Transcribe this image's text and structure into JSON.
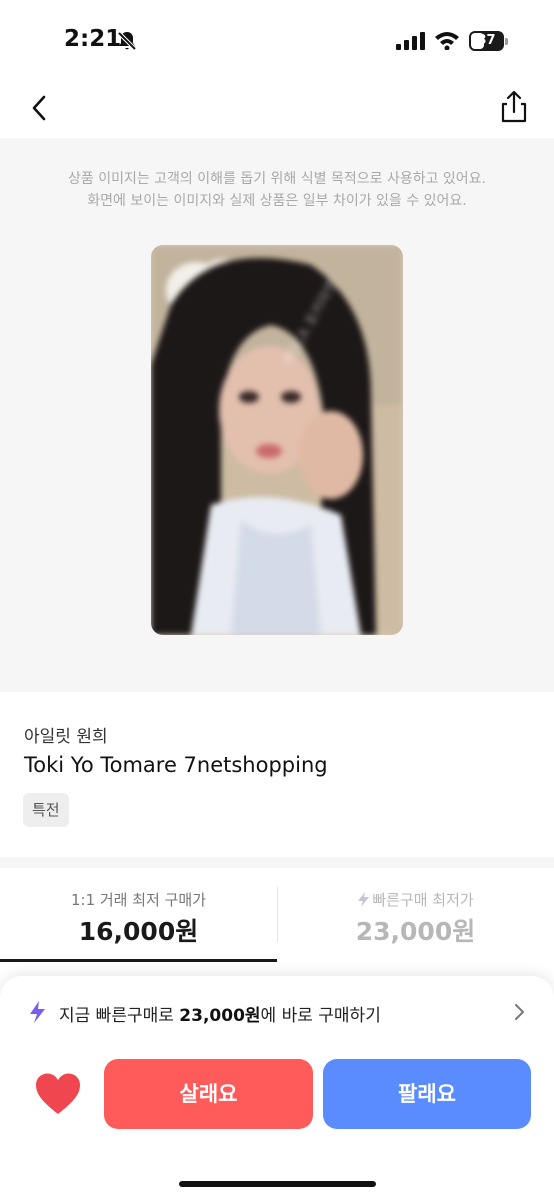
{
  "status_bar": {
    "time": "2:21",
    "battery_level": "37",
    "icons": [
      "bell-slash-icon",
      "signal-icon",
      "wifi-icon",
      "battery-icon"
    ]
  },
  "nav": {
    "back_icon": "chevron-left-icon",
    "share_icon": "share-icon"
  },
  "image_section": {
    "notice_line1": "상품 이미지는 고객의 이해를 돕기 위해 식별 목적으로 사용하고 있어요.",
    "notice_line2": "화면에 보이는 이미지와 실제 상품은 일부 차이가 있을 수 있어요.",
    "watermark": "POCA 포카마켓"
  },
  "product": {
    "artist": "아일릿 원희",
    "title": "Toki Yo Tomare 7netshopping",
    "tag": "특전"
  },
  "price_tabs": {
    "left_label": "1:1 거래 최저 구매가",
    "left_price": "16,000원",
    "right_label": "빠른구매 최저가",
    "right_price": "23,000원",
    "selected": "left"
  },
  "quick_buy": {
    "prefix": "지금 빠른구매로 ",
    "price": "23,000원",
    "suffix": "에 바로 구매하기"
  },
  "actions": {
    "buy_label": "살래요",
    "sell_label": "팔래요"
  },
  "colors": {
    "buy": "#ff5b5b",
    "sell": "#5b8cff",
    "heart": "#f0464f",
    "lightning": "#7b5cf0"
  }
}
